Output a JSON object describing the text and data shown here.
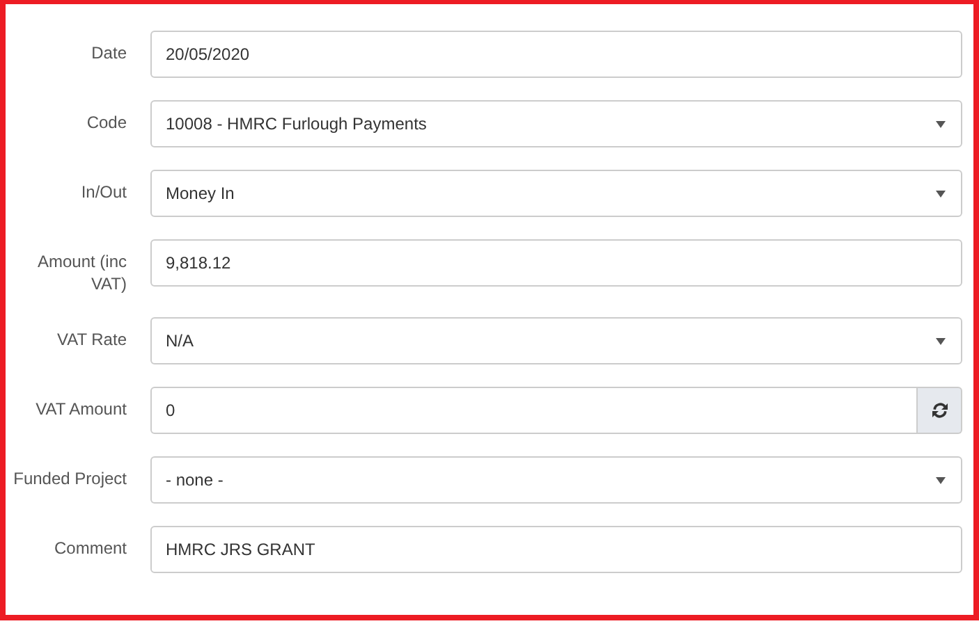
{
  "fields": [
    {
      "label": "Date",
      "kind": "text",
      "value": "20/05/2020"
    },
    {
      "label": "Code",
      "kind": "select",
      "value": "10008 - HMRC Furlough Payments"
    },
    {
      "label": "In/Out",
      "kind": "select",
      "value": "Money In"
    },
    {
      "label": "Amount (inc VAT)",
      "kind": "text",
      "value": "9,818.12"
    },
    {
      "label": "VAT Rate",
      "kind": "select",
      "value": "N/A"
    },
    {
      "label": "VAT Amount",
      "kind": "refresh",
      "value": "0"
    },
    {
      "label": "Funded Project",
      "kind": "select",
      "value": "- none -"
    },
    {
      "label": "Comment",
      "kind": "text",
      "value": "HMRC JRS GRANT"
    }
  ]
}
